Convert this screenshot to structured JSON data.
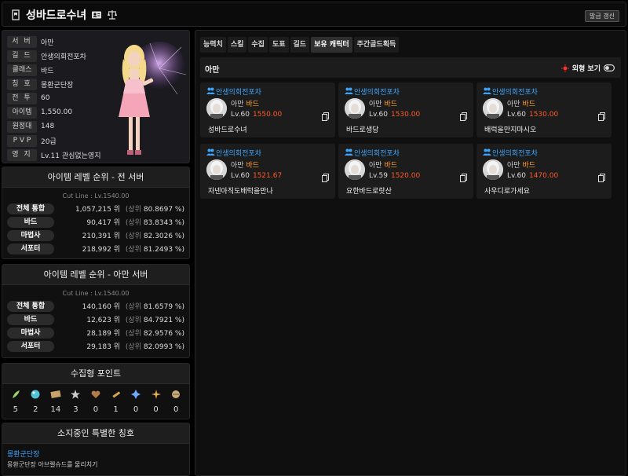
{
  "header": {
    "title": "성바드로수녀",
    "refresh_label": "발급 갱신"
  },
  "profile": {
    "rows": [
      {
        "label": "서 버",
        "value": "아만"
      },
      {
        "label": "길 드",
        "value": "안생의회전포차"
      },
      {
        "label": "클래스",
        "value": "바드"
      },
      {
        "label": "칭 호",
        "value": "몽환군단장"
      },
      {
        "label": "전 투",
        "value": "60"
      },
      {
        "label": "아이템",
        "value": "1,550.00"
      },
      {
        "label": "원정대",
        "value": "148"
      },
      {
        "label": "P V P",
        "value": "20급"
      },
      {
        "label": "영 지",
        "value": "Lv.11 관심없는영지"
      }
    ]
  },
  "rank_all": {
    "title": "아이템 레벨 순위 - 전 서버",
    "cutline": "Cut Line : Lv.1540.00",
    "rows": [
      {
        "label": "전체 통합",
        "rank": "1,057,215 위",
        "pre": "(상위",
        "pct": "80.8697 %)"
      },
      {
        "label": "바드",
        "rank": "90,417 위",
        "pre": "(상위",
        "pct": "83.8343 %)"
      },
      {
        "label": "마법사",
        "rank": "210,391 위",
        "pre": "(상위",
        "pct": "82.3026 %)"
      },
      {
        "label": "서포터",
        "rank": "218,992 위",
        "pre": "(상위",
        "pct": "81.2493 %)"
      }
    ]
  },
  "rank_server": {
    "title": "아이템 레벨 순위 - 아만 서버",
    "cutline": "Cut Line : Lv.1540.00",
    "rows": [
      {
        "label": "전체 통합",
        "rank": "140,160 위",
        "pre": "(상위",
        "pct": "81.6579 %)"
      },
      {
        "label": "바드",
        "rank": "12,623 위",
        "pre": "(상위",
        "pct": "84.7921 %)"
      },
      {
        "label": "마법사",
        "rank": "28,189 위",
        "pre": "(상위",
        "pct": "82.9576 %)"
      },
      {
        "label": "서포터",
        "rank": "29,183 위",
        "pre": "(상위",
        "pct": "82.0993 %)"
      }
    ]
  },
  "collect": {
    "title": "수집형 포인트",
    "items": [
      {
        "icon": "mokoko-seed-icon",
        "count": "5",
        "color": "#9bd36a"
      },
      {
        "icon": "island-heart-icon",
        "count": "2",
        "color": "#4fc3d9"
      },
      {
        "icon": "great-art-icon",
        "count": "14",
        "color": "#c9a46a"
      },
      {
        "icon": "omnium-star-icon",
        "count": "3",
        "color": "#cccccc"
      },
      {
        "icon": "giant-heart-icon",
        "count": "0",
        "color": "#b37a4a"
      },
      {
        "icon": "ignea-token-icon",
        "count": "1",
        "color": "#d9a04f"
      },
      {
        "icon": "world-tree-leaf-icon",
        "count": "0",
        "color": "#6fa8ff"
      },
      {
        "icon": "orpheus-star-icon",
        "count": "0",
        "color": "#e8b04a"
      },
      {
        "icon": "sea-bounty-icon",
        "count": "0",
        "color": "#c8a878"
      }
    ]
  },
  "titles": {
    "title": "소지중인 특별한 칭호",
    "name": "몽환군단장",
    "desc": "몽환군단장 아브렐슈드를 물리치기"
  },
  "tabs": [
    "능력치",
    "스킬",
    "수집",
    "도표",
    "길드",
    "보유 캐릭터",
    "주간골드획득"
  ],
  "active_tab": 5,
  "server_bar": {
    "name": "아만",
    "look_label": "외형 보기"
  },
  "characters": [
    {
      "guild": "안생의회전포차",
      "server": "아만",
      "cls": "바드",
      "lv": "Lv.60",
      "il": "1550.00",
      "name": "성바드로수녀"
    },
    {
      "guild": "안생의회전포차",
      "server": "아만",
      "cls": "바드",
      "lv": "Lv.60",
      "il": "1530.00",
      "name": "바드로생당"
    },
    {
      "guild": "안생의회전포차",
      "server": "아만",
      "cls": "바드",
      "lv": "Lv.60",
      "il": "1530.00",
      "name": "배럭을만지마시오"
    },
    {
      "guild": "안생의회전포차",
      "server": "아만",
      "cls": "바드",
      "lv": "Lv.60",
      "il": "1521.67",
      "name": "자넨아직도배럭을만나"
    },
    {
      "guild": "안생의회전포차",
      "server": "아만",
      "cls": "바드",
      "lv": "Lv.59",
      "il": "1520.00",
      "name": "요한바드로랏산"
    },
    {
      "guild": "안생의회전포차",
      "server": "아만",
      "cls": "바드",
      "lv": "Lv.60",
      "il": "1470.00",
      "name": "사우디로가세요"
    }
  ]
}
